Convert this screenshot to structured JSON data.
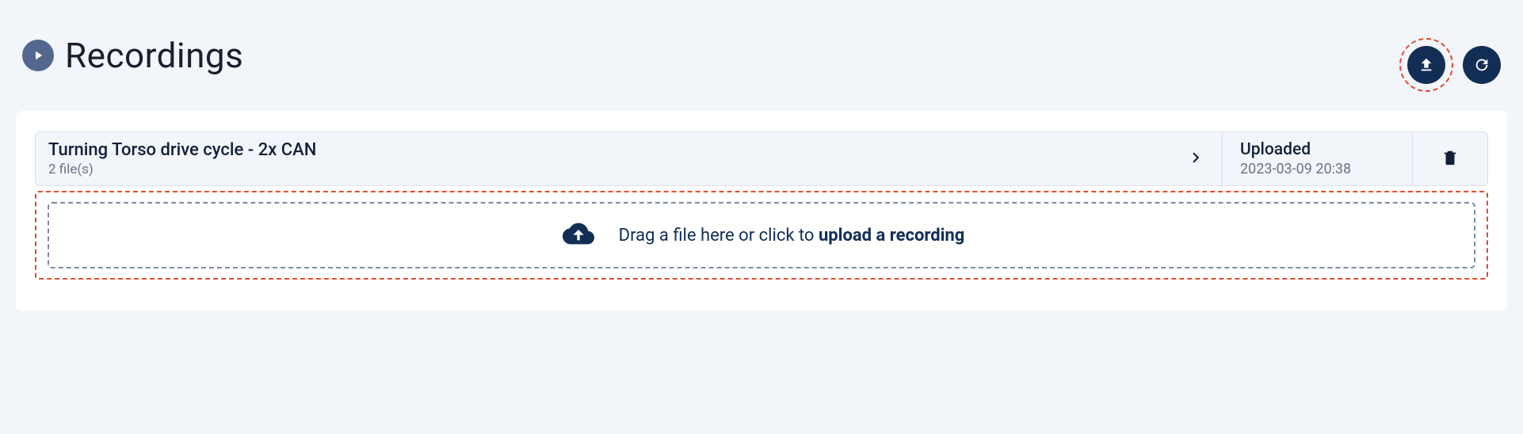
{
  "page": {
    "title": "Recordings"
  },
  "recording": {
    "name": "Turning Torso drive cycle - 2x CAN",
    "file_count": "2 file(s)",
    "status_label": "Uploaded",
    "uploaded_at": "2023-03-09 20:38"
  },
  "dropzone": {
    "prefix": "Drag a file here or click to ",
    "strong": "upload a recording"
  }
}
